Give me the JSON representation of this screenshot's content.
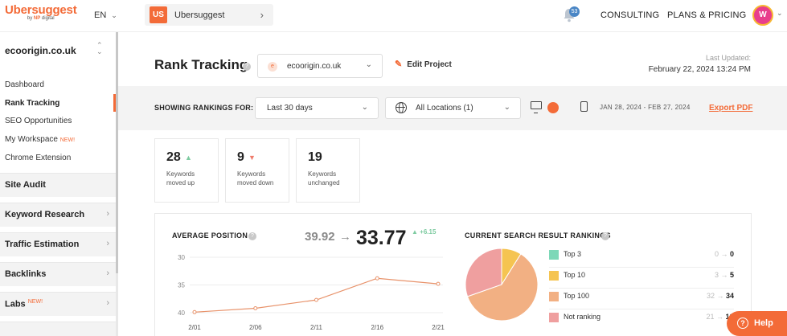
{
  "header": {
    "logo": "Ubersuggest",
    "logo_sub_prefix": "by",
    "logo_sub_brand": "NP",
    "logo_sub_suffix": "digital",
    "language": "EN",
    "project_badge": "US",
    "project_name": "Ubersuggest",
    "notification_count": "53",
    "consulting": "CONSULTING",
    "plans": "PLANS & PRICING",
    "avatar_initial": "W"
  },
  "sidebar": {
    "site": "ecoorigin.co.uk",
    "subitems": [
      {
        "label": "Dashboard"
      },
      {
        "label": "Rank Tracking"
      },
      {
        "label": "SEO Opportunities"
      },
      {
        "label": "My Workspace",
        "badge": "NEW!"
      },
      {
        "label": "Chrome Extension"
      }
    ],
    "groups": [
      {
        "label": "Site Audit"
      },
      {
        "label": "Keyword Research"
      },
      {
        "label": "Traffic Estimation"
      },
      {
        "label": "Backlinks"
      },
      {
        "label": "Labs",
        "badge": "NEW!"
      }
    ]
  },
  "page": {
    "title": "Rank Tracking",
    "domain": "ecoorigin.co.uk",
    "edit_project": "Edit Project",
    "last_updated_label": "Last Updated:",
    "last_updated_value": "February 22, 2024 13:24 PM"
  },
  "filters": {
    "showing_label": "SHOWING RANKINGS FOR:",
    "period": "Last 30 days",
    "location": "All Locations (1)",
    "device_selected": "desktop",
    "date_range": "JAN 28, 2024 - FEB 27, 2024",
    "export": "Export PDF"
  },
  "stats": [
    {
      "value": "28",
      "label_line1": "Keywords",
      "label_line2": "moved up",
      "direction": "up"
    },
    {
      "value": "9",
      "label_line1": "Keywords",
      "label_line2": "moved down",
      "direction": "down"
    },
    {
      "value": "19",
      "label_line1": "Keywords",
      "label_line2": "unchanged",
      "direction": "none"
    }
  ],
  "average_position": {
    "title": "AVERAGE POSITION",
    "from": "39.92",
    "arrow": "→",
    "to": "33.77",
    "change": "+6.15"
  },
  "current_rankings": {
    "title": "CURRENT SEARCH RESULT RANKINGS",
    "items": [
      {
        "label": "Top 3",
        "from": "0",
        "to": "0",
        "color": "#7dd8b8"
      },
      {
        "label": "Top 10",
        "from": "3",
        "to": "5",
        "color": "#f5c451"
      },
      {
        "label": "Top 100",
        "from": "32",
        "to": "34",
        "color": "#f2b083"
      },
      {
        "label": "Not ranking",
        "from": "21",
        "to": "1?",
        "color": "#ef9f9f"
      }
    ]
  },
  "chart_data": [
    {
      "type": "line",
      "title": "AVERAGE POSITION",
      "x": [
        "2/01",
        "2/06",
        "2/11",
        "2/16",
        "2/21"
      ],
      "series": [
        {
          "values": [
            39.9,
            39.2,
            37.7,
            33.8,
            34.8
          ]
        }
      ],
      "y_ticks": [
        30,
        35,
        40
      ],
      "ylim": [
        40,
        30
      ],
      "y_inverted": true,
      "color": "#e8926a"
    },
    {
      "type": "pie",
      "title": "CURRENT SEARCH RESULT RANKINGS",
      "categories": [
        "Top 10",
        "Top 100",
        "Not ranking"
      ],
      "values": [
        5,
        34,
        17
      ],
      "colors": [
        "#f5c451",
        "#f2b083",
        "#ef9f9f"
      ]
    }
  ],
  "help": {
    "label": "Help"
  }
}
